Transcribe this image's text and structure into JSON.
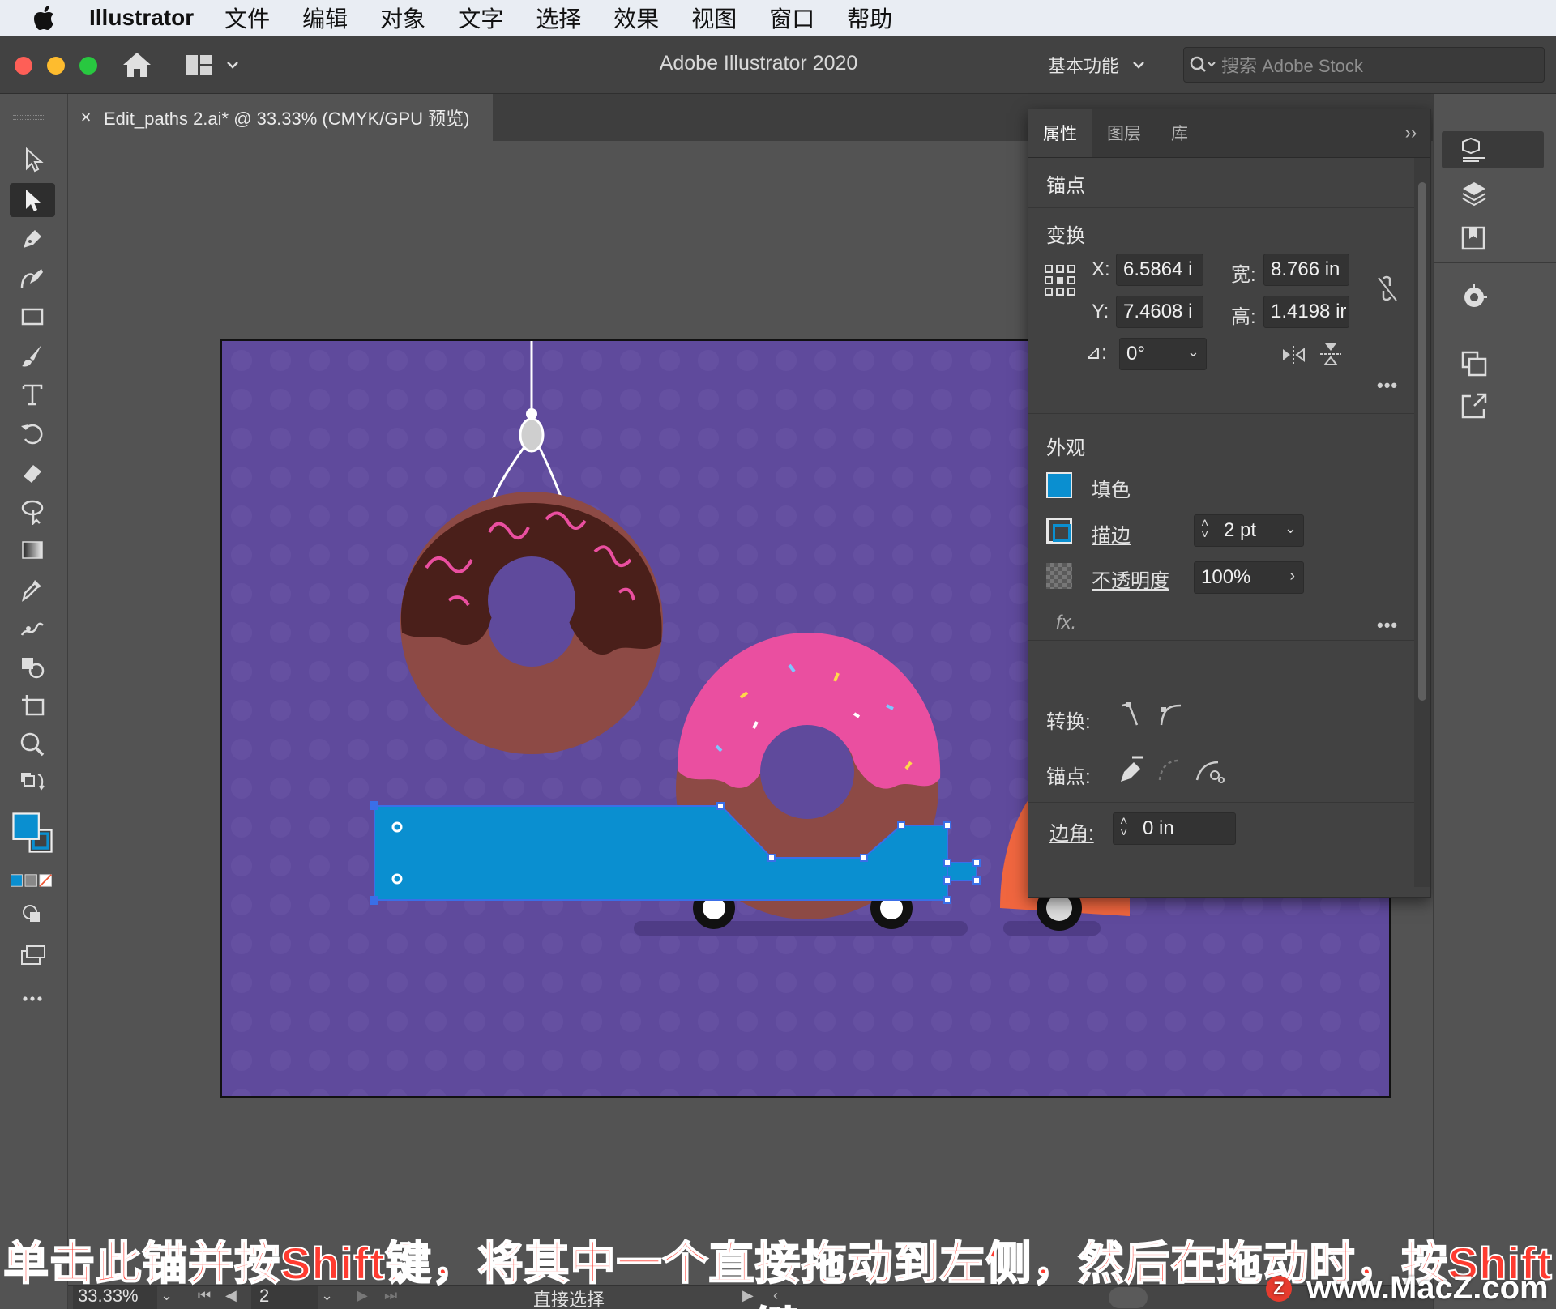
{
  "menubar": {
    "app_name": "Illustrator",
    "items": [
      "文件",
      "编辑",
      "对象",
      "文字",
      "选择",
      "效果",
      "视图",
      "窗口",
      "帮助"
    ]
  },
  "appbar": {
    "title": "Adobe Illustrator 2020",
    "workspace": "基本功能",
    "search_placeholder": "搜索 Adobe Stock"
  },
  "document_tab": {
    "close_label": "×",
    "title": "Edit_paths 2.ai* @ 33.33% (CMYK/GPU 预览)"
  },
  "properties_panel": {
    "tabs": [
      "属性",
      "图层",
      "库"
    ],
    "selection_type": "锚点",
    "transform": {
      "heading": "变换",
      "x_label": "X:",
      "x_value": "6.5864 i",
      "y_label": "Y:",
      "y_value": "7.4608 i",
      "w_label": "宽:",
      "w_value": "8.766 in",
      "h_label": "高:",
      "h_value": "1.4198 ir",
      "angle_label": "⊿:",
      "angle_value": "0°"
    },
    "appearance": {
      "heading": "外观",
      "fill_label": "填色",
      "stroke_label": "描边",
      "stroke_weight": "2 pt",
      "opacity_label": "不透明度",
      "opacity_value": "100%",
      "fx_label": "fx."
    },
    "convert_label": "转换:",
    "anchor_label": "锚点:",
    "corner_label": "边角:",
    "corner_value": "0 in",
    "more_dots": "•••"
  },
  "statusbar": {
    "zoom": "33.33%",
    "page": "2",
    "tool": "直接选择"
  },
  "subtitle": "单击此锚并按Shift键，将其中一个直接拖动到左侧，然后在拖动时，按Shift键",
  "watermark": "www.MacZ.com",
  "colors": {
    "artboard_bg": "#5f4a9c",
    "truck_blue": "#0a8fd0",
    "car_orange": "#f0663f",
    "donut_pink": "#ea4fa0",
    "icing_chocolate": "#4a1f1a",
    "dough": "#8d4a45"
  }
}
